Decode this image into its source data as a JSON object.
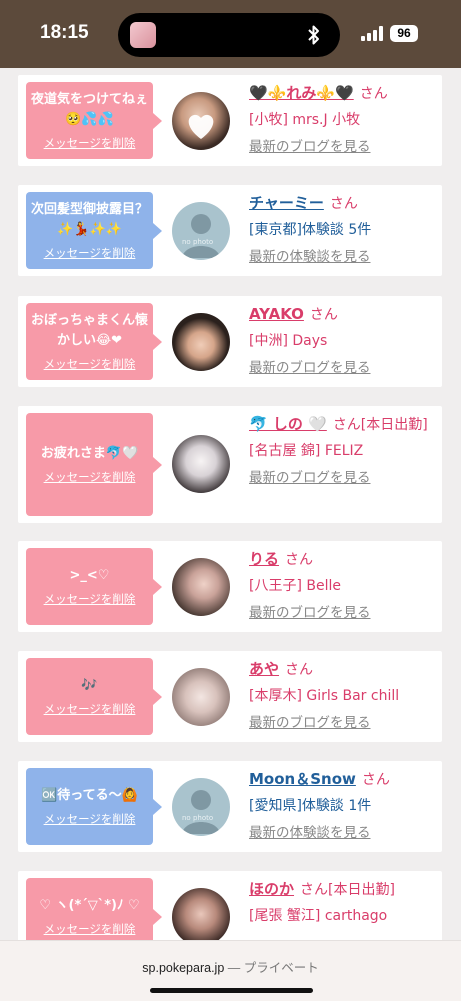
{
  "status": {
    "time": "18:15",
    "battery": "96"
  },
  "cards": [
    {
      "message": "夜道気をつけてねぇ🥺💦💦",
      "delete_label": "メッセージを削除",
      "bubble_color": "pink",
      "name": "🖤⚜️れみ⚜️🖤",
      "name_color": "pink",
      "suffix": "さん",
      "shop": "[小牧] mrs.J 小牧",
      "shop_color": "pink",
      "link": "最新のブログを見る",
      "avatar": "photo"
    },
    {
      "message": "次回髪型御披露目？✨💃✨✨",
      "delete_label": "メッセージを削除",
      "bubble_color": "blue",
      "name": "チャーミー",
      "name_color": "blue",
      "suffix": "さん",
      "shop": "[東京都]体験談 5件",
      "shop_color": "blue",
      "link": "最新の体験談を見る",
      "avatar": "no-photo"
    },
    {
      "message": "おぼっちゃまくん懐かしい😂❤",
      "delete_label": "メッセージを削除",
      "bubble_color": "pink",
      "name": "AYAKO",
      "name_color": "pink",
      "suffix": "さん",
      "shop": "[中洲] Days",
      "shop_color": "pink",
      "link": "最新のブログを見る",
      "avatar": "photo"
    },
    {
      "message": "お疲れさま🐬🤍",
      "delete_label": "メッセージを削除",
      "bubble_color": "pink",
      "name": "🐬 しの 🤍",
      "name_color": "pink",
      "suffix": "さん[本日出勤]",
      "shop": "[名古屋 錦] FELIZ",
      "shop_color": "pink",
      "link": "最新のブログを見る",
      "avatar": "photo"
    },
    {
      "message": ">_<♡",
      "delete_label": "メッセージを削除",
      "bubble_color": "pink",
      "name": "りる",
      "name_color": "pink",
      "suffix": "さん",
      "shop": "[八王子] Belle",
      "shop_color": "pink",
      "link": "最新のブログを見る",
      "avatar": "photo"
    },
    {
      "message": "🎶",
      "delete_label": "メッセージを削除",
      "bubble_color": "pink",
      "name": "あや",
      "name_color": "pink",
      "suffix": "さん",
      "shop": "[本厚木] Girls Bar chill",
      "shop_color": "pink",
      "link": "最新のブログを見る",
      "avatar": "photo"
    },
    {
      "message": "🆗待ってる〜🙆",
      "delete_label": "メッセージを削除",
      "bubble_color": "blue",
      "name": "Moon＆Snow",
      "name_color": "blue",
      "suffix": "さん",
      "shop": "[愛知県]体験談 1件",
      "shop_color": "blue",
      "link": "最新の体験談を見る",
      "avatar": "no-photo"
    },
    {
      "message": "♡ ヽ(*´▽`*)ﾉ ♡",
      "delete_label": "メッセージを削除",
      "bubble_color": "pink",
      "name": "ほのか",
      "name_color": "pink",
      "suffix": "さん[本日出勤]",
      "shop": "[尾張 蟹江] carthago",
      "shop_color": "pink",
      "link": "",
      "avatar": "photo"
    }
  ],
  "avatar_labels": {
    "no_photo": "no photo"
  },
  "browser": {
    "url": "sp.pokepara.jp",
    "suffix": " — プライベート"
  },
  "colors": {
    "pink_bubble": "#f79aa8",
    "blue_bubble": "#8fb3ea",
    "pink_text": "#d93d6a",
    "blue_text": "#215f9a"
  }
}
